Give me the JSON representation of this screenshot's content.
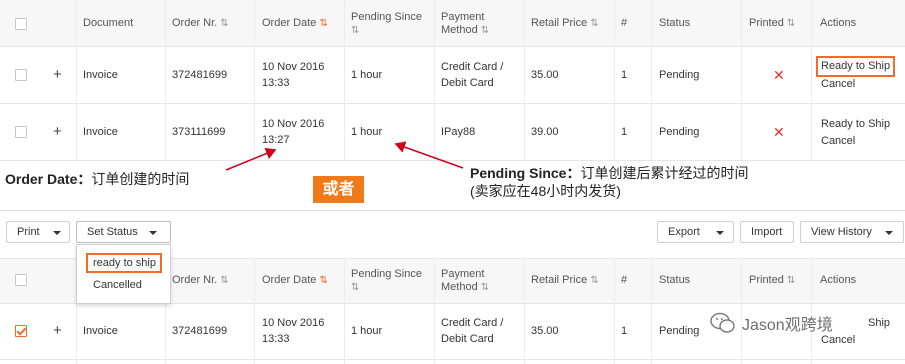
{
  "columns": {
    "document": "Document",
    "order_nr": "Order Nr.",
    "order_date": "Order Date",
    "pending_since": "Pending Since",
    "payment_method": "Payment Method",
    "retail_price": "Retail Price",
    "count": "#",
    "status": "Status",
    "printed": "Printed",
    "actions": "Actions"
  },
  "sort_icons": {
    "neutral": "⇅",
    "active": "⇅"
  },
  "top_rows": [
    {
      "document": "Invoice",
      "order_nr": "372481699",
      "date_line1": "10 Nov 2016",
      "date_line2": "13:33",
      "pending_since": "1 hour",
      "payment_line1": "Credit Card /",
      "payment_line2": "Debit Card",
      "retail_price": "35.00",
      "count": "1",
      "status": "Pending",
      "printed": "✕",
      "action1": "Ready to Ship",
      "action2": "Cancel"
    },
    {
      "document": "Invoice",
      "order_nr": "373111699",
      "date_line1": "10 Nov 2016",
      "date_line2": "13:27",
      "pending_since": "1 hour",
      "payment_line1": "IPay88",
      "payment_line2": "",
      "retail_price": "39.00",
      "count": "1",
      "status": "Pending",
      "printed": "✕",
      "action1": "Ready to Ship",
      "action2": "Cancel"
    }
  ],
  "annotations": {
    "order_date_label": "Order Date：",
    "order_date_desc": "订单创建的时间",
    "pending_label": "Pending Since：",
    "pending_desc": "订单创建后累计经过的时间",
    "pending_note": "(卖家应在48小时内发货)",
    "or_badge": "或者",
    "arrow_color": "#d0021b",
    "badge_color": "#f07a1a"
  },
  "toolbar": {
    "print": "Print",
    "set_status": "Set Status",
    "export": "Export",
    "import": "Import",
    "view_history": "View History"
  },
  "status_dropdown": {
    "options": [
      "ready to ship",
      "Cancelled"
    ]
  },
  "bottom_row": {
    "document": "Invoice",
    "order_nr": "372481699",
    "date_line1": "10 Nov 2016",
    "date_line2": "13:33",
    "pending_since": "1 hour",
    "payment_line1": "Credit Card /",
    "payment_line2": "Debit Card",
    "retail_price": "35.00",
    "count": "1",
    "status": "Pending",
    "action1": "Ship",
    "action2": "Cancel",
    "checked": true
  },
  "watermark": {
    "text": "Jason观跨境"
  },
  "colors": {
    "accent": "#f26b2a",
    "link": "#3a7bd5",
    "header_bg": "#f7f7f7",
    "x_red": "#e0302b"
  }
}
